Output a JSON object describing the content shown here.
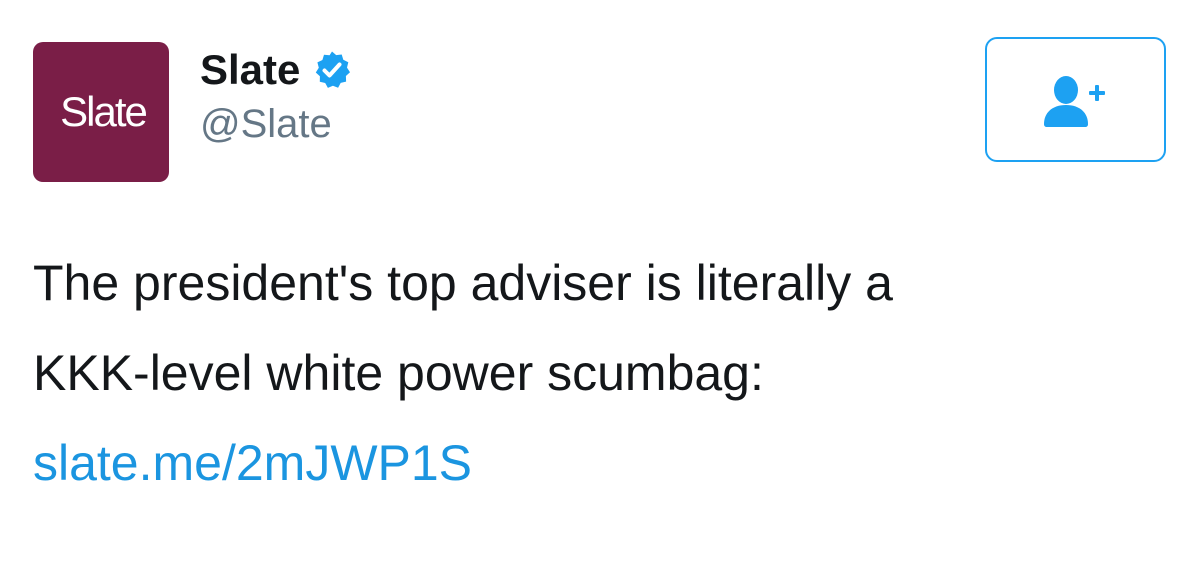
{
  "account": {
    "avatar_text": "Slate",
    "display_name": "Slate",
    "handle": "@Slate",
    "verified": true
  },
  "follow_button": {
    "icon": "add-user-icon"
  },
  "tweet": {
    "line1": "The president's top adviser is literally a",
    "line2": "KKK-level white power scumbag:",
    "link": "slate.me/2mJWP1S"
  },
  "colors": {
    "avatar_bg": "#7a1e47",
    "accent": "#1da1f2",
    "link": "#1b95e0",
    "handle": "#657786",
    "text": "#14171a"
  }
}
